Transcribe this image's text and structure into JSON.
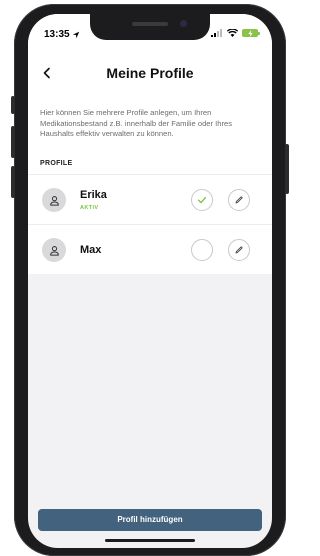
{
  "status_bar": {
    "time": "13:35",
    "icons": [
      "location-arrow-icon",
      "signal-icon",
      "wifi-icon",
      "battery-charging-icon"
    ],
    "battery_color": "#8ac24a"
  },
  "header": {
    "title": "Meine Profile",
    "back_icon": "chevron-left-icon"
  },
  "intro": {
    "text": "Hier können Sie mehrere Profile anlegen, um Ihren Medikationsbestand z.B. innerhalb der Familie oder Ihres Haushalts effektiv verwalten zu können."
  },
  "profiles": {
    "section_label": "PROFILE",
    "items": [
      {
        "name": "Erika",
        "status": "AKTIV",
        "selected": true
      },
      {
        "name": "Max",
        "status": "",
        "selected": false
      }
    ]
  },
  "footer": {
    "add_profile_label": "Profil hinzufügen"
  },
  "colors": {
    "accent": "#43627e",
    "active_green": "#7cc242",
    "background": "#f2f2f4"
  }
}
